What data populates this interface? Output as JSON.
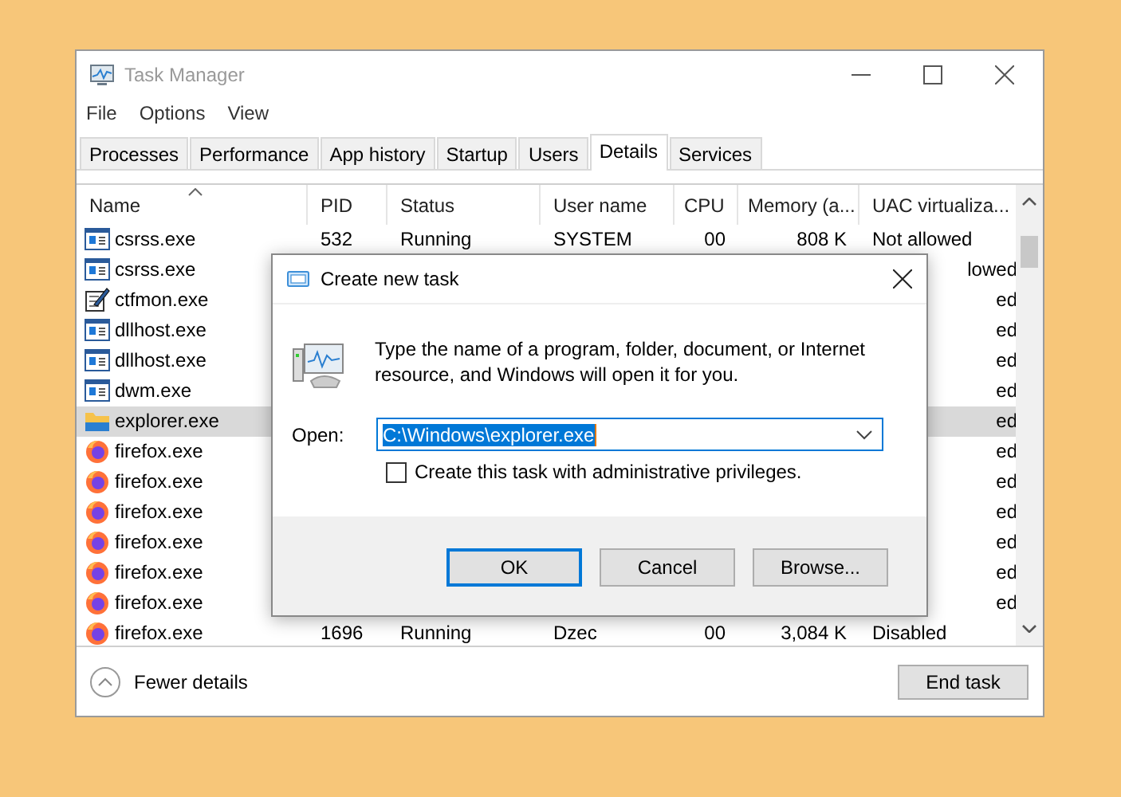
{
  "window": {
    "title": "Task Manager"
  },
  "menu": [
    "File",
    "Options",
    "View"
  ],
  "tabs": [
    {
      "label": "Processes",
      "selected": false
    },
    {
      "label": "Performance",
      "selected": false
    },
    {
      "label": "App history",
      "selected": false
    },
    {
      "label": "Startup",
      "selected": false
    },
    {
      "label": "Users",
      "selected": false
    },
    {
      "label": "Details",
      "selected": true
    },
    {
      "label": "Services",
      "selected": false
    }
  ],
  "table": {
    "columns": [
      "Name",
      "PID",
      "Status",
      "User name",
      "CPU",
      "Memory (a...",
      "UAC virtualiza..."
    ],
    "rows": [
      {
        "name": "csrss.exe",
        "kind": "app",
        "selected": false,
        "cells": [
          "532",
          "Running",
          "SYSTEM",
          "00",
          "808 K",
          "Not allowed"
        ]
      },
      {
        "name": "csrss.exe",
        "kind": "app",
        "selected": false,
        "uac": "lowed"
      },
      {
        "name": "ctfmon.exe",
        "kind": "pen",
        "selected": false,
        "uac": "ed"
      },
      {
        "name": "dllhost.exe",
        "kind": "app",
        "selected": false,
        "uac": "ed"
      },
      {
        "name": "dllhost.exe",
        "kind": "app",
        "selected": false,
        "uac": "ed"
      },
      {
        "name": "dwm.exe",
        "kind": "app",
        "selected": false,
        "uac": "ed"
      },
      {
        "name": "explorer.exe",
        "kind": "folder",
        "selected": true,
        "uac": "ed"
      },
      {
        "name": "firefox.exe",
        "kind": "firefox",
        "selected": false,
        "uac": "ed"
      },
      {
        "name": "firefox.exe",
        "kind": "firefox",
        "selected": false,
        "uac": "ed"
      },
      {
        "name": "firefox.exe",
        "kind": "firefox",
        "selected": false,
        "uac": "ed"
      },
      {
        "name": "firefox.exe",
        "kind": "firefox",
        "selected": false,
        "uac": "ed"
      },
      {
        "name": "firefox.exe",
        "kind": "firefox",
        "selected": false,
        "uac": "ed"
      },
      {
        "name": "firefox.exe",
        "kind": "firefox",
        "selected": false,
        "uac": "ed"
      },
      {
        "name": "firefox.exe",
        "kind": "firefox",
        "selected": false,
        "cells": [
          "1696",
          "Running",
          "Dzec",
          "00",
          "3,084 K",
          "Disabled"
        ]
      }
    ]
  },
  "footer": {
    "toggle": "Fewer details",
    "button": "End task"
  },
  "dialog": {
    "title": "Create new task",
    "message": "Type the name of a program, folder, document, or Internet resource, and Windows will open it for you.",
    "open_label": "Open:",
    "value": "C:\\Windows\\explorer.exe",
    "checkbox": {
      "label": "Create this task with administrative privileges.",
      "checked": false
    },
    "buttons": [
      {
        "label": "OK",
        "default": true
      },
      {
        "label": "Cancel",
        "default": false
      },
      {
        "label": "Browse...",
        "default": false
      }
    ]
  }
}
